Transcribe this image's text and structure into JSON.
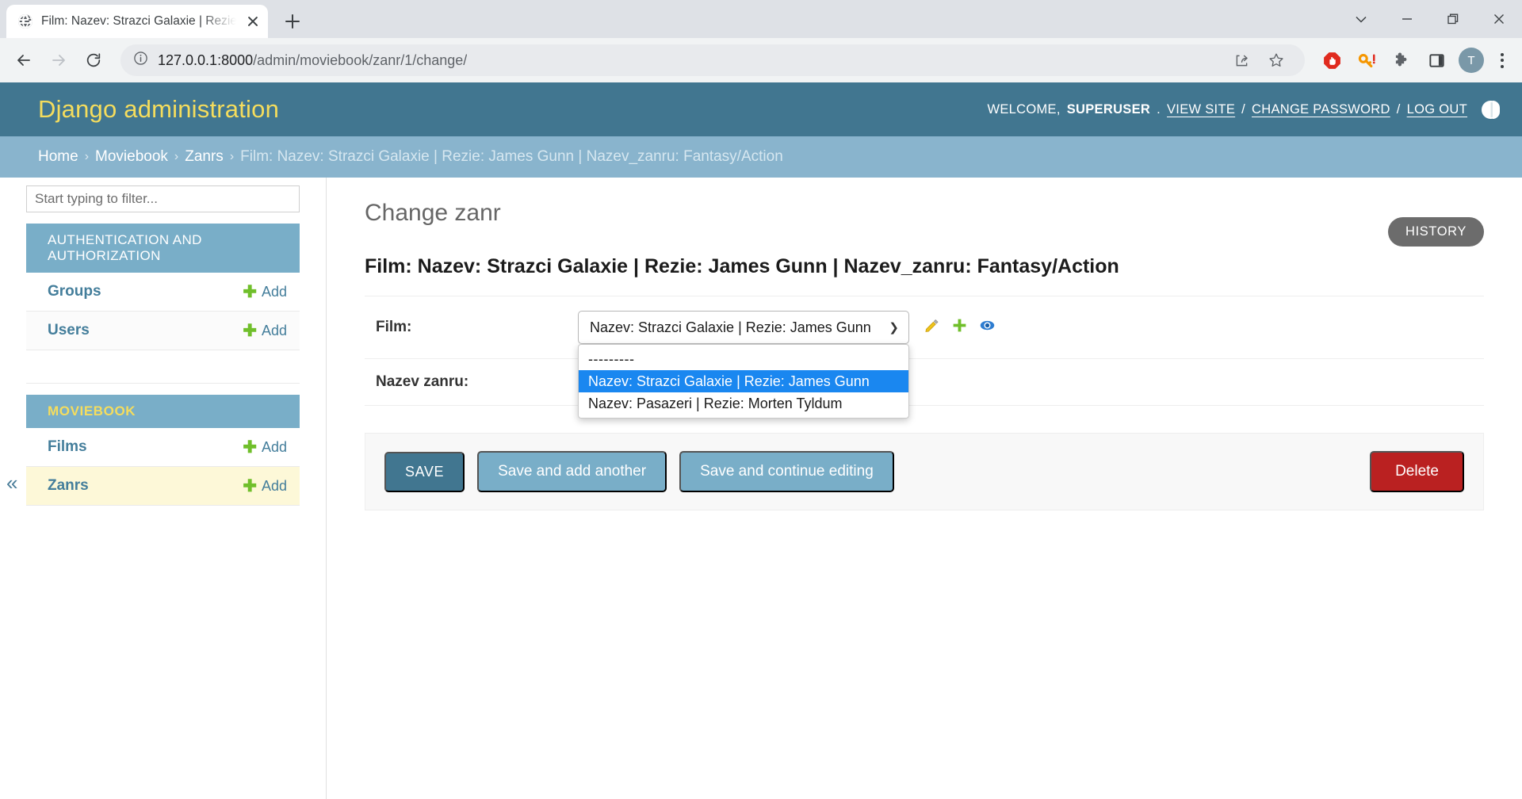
{
  "browser": {
    "tab": {
      "title": "Film: Nazev: Strazci Galaxie | Rezie",
      "favicon_name": "globe-icon"
    },
    "new_tab_label": "+",
    "url_host": "127.0.0.1:8000",
    "url_path": "/admin/moviebook/zanr/1/change/",
    "avatar_letter": "T",
    "toolbar_icons": [
      "back-icon",
      "forward-icon",
      "reload-icon",
      "site-info-icon",
      "share-icon",
      "bookmark-star-icon",
      "adblock-icon",
      "password-key-icon",
      "extensions-puzzle-icon",
      "side-panel-icon",
      "profile-avatar",
      "menu-kebab-icon"
    ],
    "window_controls": [
      "tab-search-icon",
      "minimize-icon",
      "maximize-icon",
      "close-icon"
    ]
  },
  "header": {
    "brand": "Django administration",
    "welcome_prefix": "WELCOME,",
    "username": "SUPERUSER",
    "period": ".",
    "view_site": "VIEW SITE",
    "sep1": "/",
    "change_password": "CHANGE PASSWORD",
    "sep2": "/",
    "log_out": "LOG OUT"
  },
  "breadcrumbs": {
    "home": "Home",
    "app": "Moviebook",
    "model": "Zanrs",
    "current": "Film: Nazev: Strazci Galaxie | Rezie: James Gunn | Nazev_zanru: Fantasy/Action",
    "separator": "›"
  },
  "sidebar": {
    "filter_placeholder": "Start typing to filter...",
    "filter_value": "",
    "collapse_label": "«",
    "apps": [
      {
        "title": "AUTHENTICATION AND AUTHORIZATION",
        "models": [
          {
            "name": "Groups",
            "add_label": "Add",
            "current": false
          },
          {
            "name": "Users",
            "add_label": "Add",
            "current": false
          }
        ]
      },
      {
        "title": "MOVIEBOOK",
        "models": [
          {
            "name": "Films",
            "add_label": "Add",
            "current": false
          },
          {
            "name": "Zanrs",
            "add_label": "Add",
            "current": true
          }
        ]
      }
    ]
  },
  "content": {
    "page_title": "Change zanr",
    "history_label": "HISTORY",
    "object_title": "Film: Nazev: Strazci Galaxie | Rezie: James Gunn | Nazev_zanru: Fantasy/Action",
    "fields": [
      {
        "label": "Film:",
        "value": "Nazev: Strazci Galaxie | Rezie: James Gunn"
      },
      {
        "label": "Nazev zanru:",
        "value": ""
      }
    ],
    "select": {
      "selected_value": "Nazev: Strazci Galaxie | Rezie: James Gunn",
      "open": true,
      "options": [
        {
          "label": "---------",
          "selected": false
        },
        {
          "label": "Nazev: Strazci Galaxie | Rezie: James Gunn",
          "selected": true
        },
        {
          "label": "Nazev: Pasazeri | Rezie: Morten Tyldum",
          "selected": false
        }
      ],
      "related_icons": [
        "edit-pencil-icon",
        "add-plus-icon",
        "view-eye-icon"
      ]
    },
    "buttons": {
      "save": "SAVE",
      "save_and_add_another": "Save and add another",
      "save_and_continue": "Save and continue editing",
      "delete": "Delete"
    }
  },
  "colors": {
    "django_header": "#417690",
    "breadcrumb_bar": "#89b4cd",
    "app_title": "#79aec8",
    "brand_yellow": "#f5dd5d",
    "link_blue": "#447e9b",
    "add_green": "#70bf2b",
    "delete_red": "#ba2121",
    "select_highlight": "#1a87f0",
    "current_row": "#fdf8d8"
  }
}
